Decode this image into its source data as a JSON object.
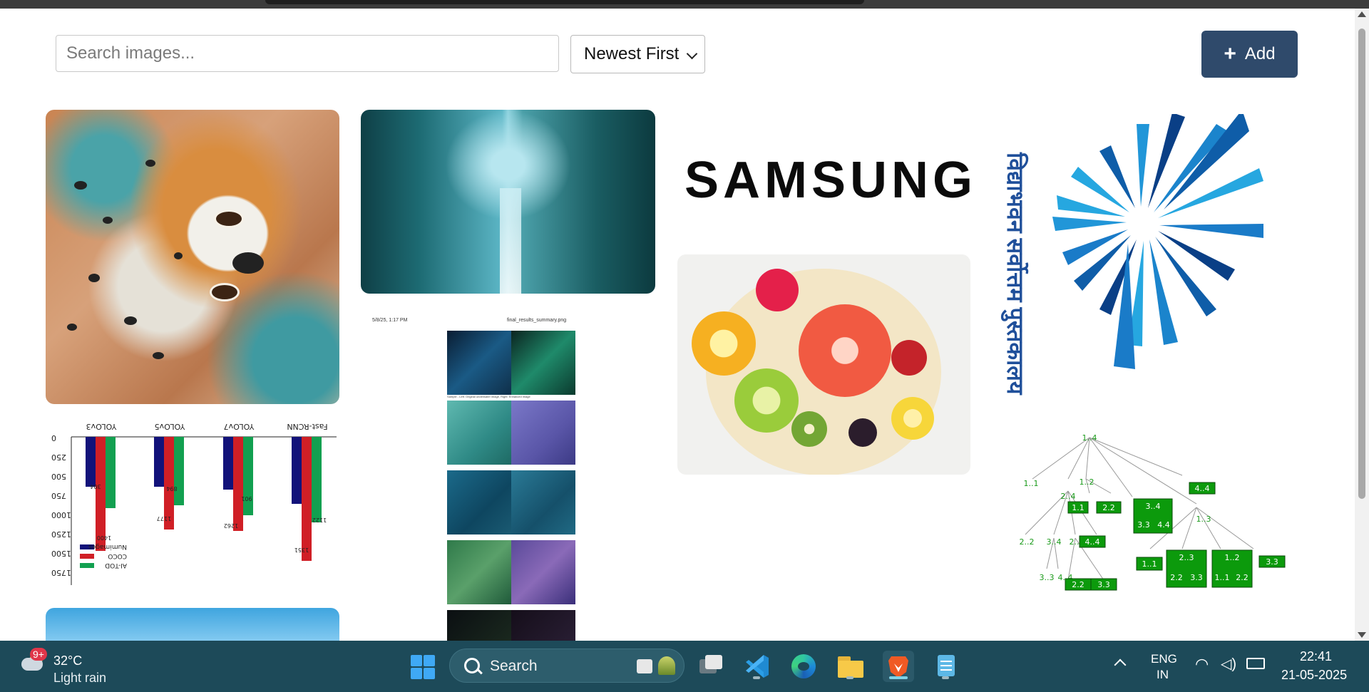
{
  "toolbar": {
    "search_placeholder": "Search images...",
    "sort_selected": "Newest First",
    "add_label": "Add"
  },
  "gallery": {
    "logo_word": "SAMSUNG",
    "hindi_logo_text": "विद्याभवन सर्वोत्तम पुस्तकालय"
  },
  "bar_chart": {
    "legend": [
      "AI-TOD",
      "COCO",
      "Numimages"
    ],
    "groups": [
      "YOLOv3",
      "YOLOv5",
      "YOLOv7",
      "Fast-RCNN"
    ],
    "yticks": [
      "0",
      "250",
      "500",
      "750",
      "1000",
      "1250",
      "1500",
      "1750"
    ],
    "data_labels": [
      "1400",
      "1177",
      "1262",
      "1351",
      "304",
      "894",
      "901",
      "1122"
    ]
  },
  "doc_preview": {
    "date": "5/8/25, 1:17 PM",
    "filename": "final_results_summary.png",
    "caption": "Sample - Left: Original underwater image, Right: Enhanced image"
  },
  "tree": {
    "root": "1..4",
    "nodes": [
      "1..1",
      "1..2",
      "2..4",
      "1.1",
      "2.2",
      "3..4",
      "3.3",
      "4.4",
      "4..4",
      "2..2",
      "3..4",
      "2..3",
      "4..4",
      "1..3",
      "1..1",
      "2..3",
      "2.2",
      "3.3",
      "1..2",
      "1..1",
      "2.2",
      "3..3",
      "3..3",
      "4..4",
      "2..2",
      "3..3"
    ]
  },
  "taskbar": {
    "weather_badge": "9+",
    "temperature": "32°C",
    "weather": "Light rain",
    "search_label": "Search",
    "lang_top": "ENG",
    "lang_bottom": "IN",
    "time": "22:41",
    "date": "21-05-2025"
  }
}
